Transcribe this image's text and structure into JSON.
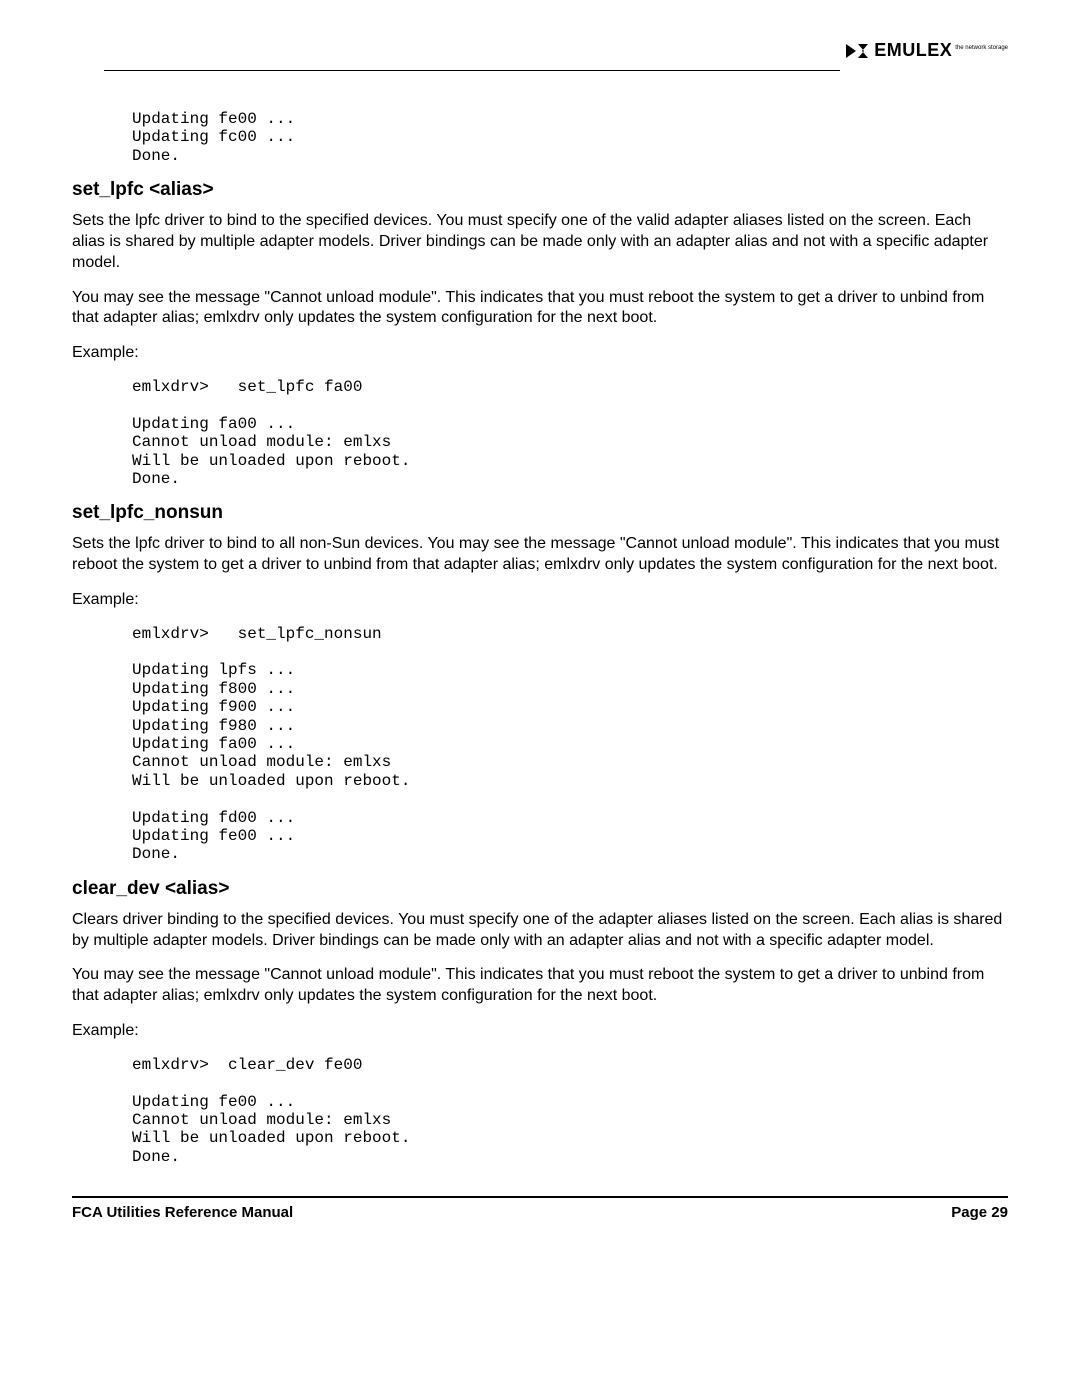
{
  "brand": {
    "name": "EMULEX",
    "sub": "the network storage"
  },
  "intro_code": "Updating fe00 ...\nUpdating fc00 ...\nDone.",
  "sections": {
    "set_lpfc": {
      "title": "set_lpfc <alias>",
      "p1": "Sets the lpfc driver to bind to the specified devices. You must specify one of the valid adapter aliases listed on the screen. Each alias is shared by multiple adapter models. Driver bindings can be made only with an adapter alias and not with a specific adapter model.",
      "p2": "You may see the message \"Cannot unload module\". This indicates that you must reboot the system to get a driver to unbind from that adapter alias; emlxdrv only updates the system configuration for the next boot.",
      "example_label": "Example:",
      "example_code": "emlxdrv>   set_lpfc fa00\n\nUpdating fa00 ...\nCannot unload module: emlxs\nWill be unloaded upon reboot.\nDone."
    },
    "set_lpfc_nonsun": {
      "title": "set_lpfc_nonsun",
      "p1": "Sets the lpfc driver to bind to all non-Sun devices. You may see the message \"Cannot unload module\". This indicates that you must reboot the system to get a driver to unbind from that adapter alias; emlxdrv only updates the system configuration for the next boot.",
      "example_label": "Example:",
      "example_code": "emlxdrv>   set_lpfc_nonsun\n\nUpdating lpfs ...\nUpdating f800 ...\nUpdating f900 ...\nUpdating f980 ...\nUpdating fa00 ...\nCannot unload module: emlxs\nWill be unloaded upon reboot.\n\nUpdating fd00 ...\nUpdating fe00 ...\nDone."
    },
    "clear_dev": {
      "title": "clear_dev <alias>",
      "p1": "Clears driver binding to the specified devices. You must specify one of the adapter aliases listed on the screen. Each alias is shared by multiple adapter models. Driver bindings can be made only with an adapter alias and not with a specific adapter model.",
      "p2": "You may see the message \"Cannot unload module\". This indicates that you must reboot the system to get a driver to unbind from that adapter alias; emlxdrv only updates the system configuration for the next boot.",
      "example_label": "Example:",
      "example_code": "emlxdrv>  clear_dev fe00\n\nUpdating fe00 ...\nCannot unload module: emlxs\nWill be unloaded upon reboot.\nDone."
    }
  },
  "footer": {
    "left": "FCA Utilities Reference Manual",
    "right": "Page 29"
  }
}
